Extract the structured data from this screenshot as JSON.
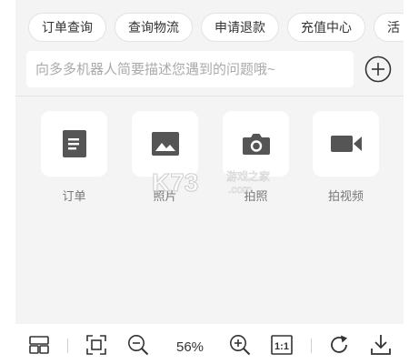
{
  "quick_chips": [
    "订单查询",
    "查询物流",
    "申请退款",
    "充值中心",
    "活"
  ],
  "input": {
    "placeholder": "向多多机器人简要描述您遇到的问题哦~",
    "value": ""
  },
  "tools": [
    {
      "label": "订单",
      "icon": "document-icon"
    },
    {
      "label": "照片",
      "icon": "image-icon"
    },
    {
      "label": "拍照",
      "icon": "camera-icon"
    },
    {
      "label": "拍视频",
      "icon": "video-camera-icon"
    }
  ],
  "watermark": {
    "brand": "K73",
    "site_text": "游戏之家",
    "domain": ".com"
  },
  "viewer_toolbar": {
    "zoom_level": "56%",
    "actual_size_label": "1:1"
  },
  "colors": {
    "stage_bg": "#f4f4f4",
    "icon_fill": "#555555",
    "text_muted": "#777777"
  }
}
